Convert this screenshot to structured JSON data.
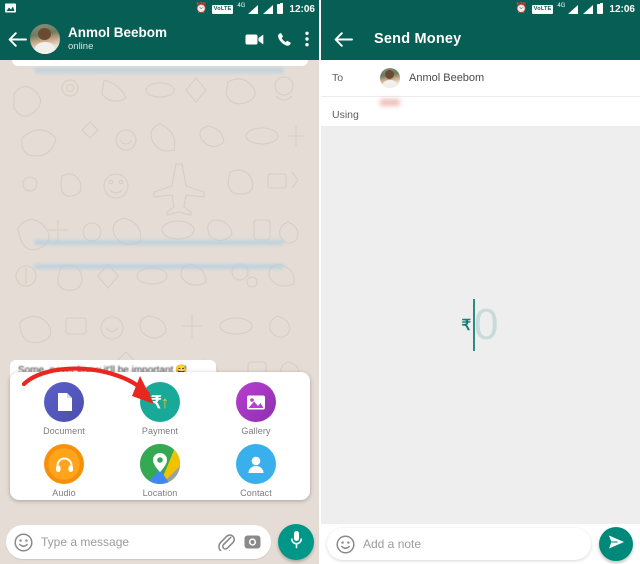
{
  "status_bar": {
    "alarm_icon": "alarm-clock-icon",
    "volte_label": "VoLTE",
    "network_label": "4G",
    "signal_icon": "signal-bars-icon",
    "battery_icon": "battery-icon",
    "time": "12:06"
  },
  "chat_screen": {
    "back_icon": "back-arrow-icon",
    "avatar": "contact-avatar",
    "contact_name": "Anmol Beebom",
    "presence": "online",
    "actions": [
      {
        "name": "video-call-icon",
        "label": "Video call"
      },
      {
        "name": "voice-call-icon",
        "label": "Voice call"
      },
      {
        "name": "overflow-menu-icon",
        "label": "More options"
      }
    ],
    "last_message": "Some, never know it'll be important",
    "last_message_emoji": "😅",
    "attachment_sheet": {
      "items": [
        {
          "label": "Document",
          "icon": "document-icon",
          "color": "#5b5fc7"
        },
        {
          "label": "Payment",
          "icon": "rupee-payment-icon",
          "color": "#18a999"
        },
        {
          "label": "Gallery",
          "icon": "gallery-icon",
          "color": "#b83fd0"
        },
        {
          "label": "Audio",
          "icon": "headphones-icon",
          "color": "#ffa41b"
        },
        {
          "label": "Location",
          "icon": "map-pin-icon",
          "color": "#34a853"
        },
        {
          "label": "Contact",
          "icon": "person-icon",
          "color": "#39b0ec"
        }
      ],
      "annotation_arrow": {
        "name": "red-annotation-arrow",
        "color": "#e8281e",
        "points_to": "Payment"
      }
    },
    "composer": {
      "emoji_icon": "emoji-smiley-icon",
      "placeholder": "Type a message",
      "value": "",
      "attach_icon": "paperclip-icon",
      "camera_icon": "camera-icon",
      "mic_icon": "microphone-icon",
      "fab_color": "#009688"
    }
  },
  "payment_screen": {
    "back_icon": "back-arrow-icon",
    "title": "Send Money",
    "rows": [
      {
        "label": "To",
        "value": "Anmol Beebom",
        "avatar": "recipient-avatar"
      },
      {
        "label": "Using",
        "value": "",
        "avatar": ""
      }
    ],
    "amount": {
      "currency_symbol": "₹",
      "placeholder": "0",
      "value": "",
      "accent_color": "#0e8074"
    },
    "note": {
      "emoji_icon": "emoji-smiley-icon",
      "placeholder": "Add a note",
      "value": "",
      "send_icon": "send-paper-plane-icon",
      "fab_color": "#00897b"
    }
  },
  "theme": {
    "appbar": "#075e54",
    "chat_background": "#e5ddd5",
    "payment_background": "#eeeeee",
    "accent": "#009688"
  }
}
